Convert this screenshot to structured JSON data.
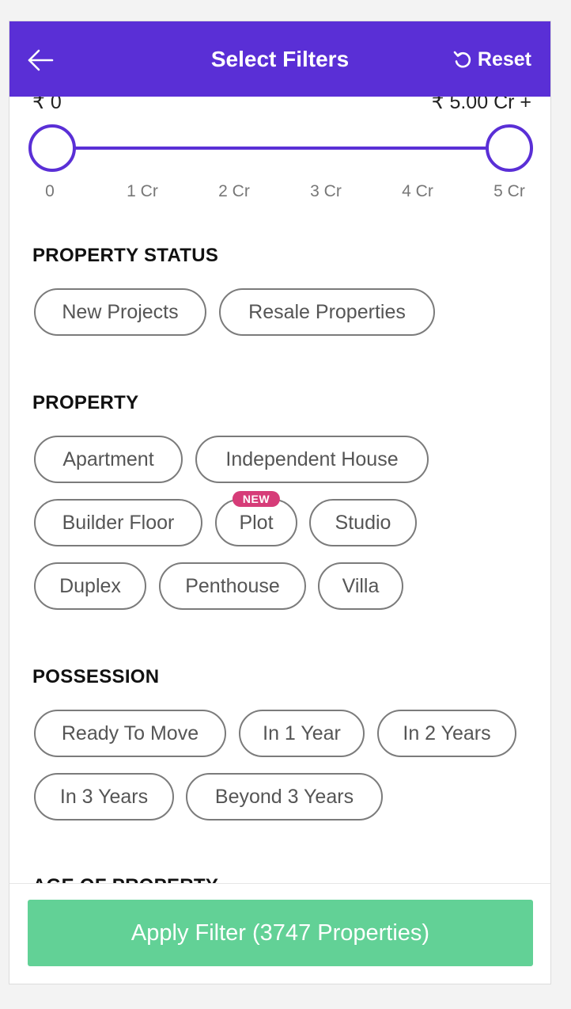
{
  "header": {
    "title": "Select Filters",
    "reset_label": "Reset",
    "back_icon": "arrow-left-icon",
    "reset_icon": "undo-icon",
    "bg_color": "#5a2fd6"
  },
  "budget": {
    "min_label": "₹ 0",
    "max_label": "₹ 5.00 Cr +",
    "ticks": [
      "0",
      "1 Cr",
      "2 Cr",
      "3 Cr",
      "4 Cr",
      "5 Cr"
    ]
  },
  "property_status": {
    "title": "PROPERTY STATUS",
    "options": [
      "New Projects",
      "Resale Properties"
    ]
  },
  "property": {
    "title": "PROPERTY",
    "options": [
      "Apartment",
      "Independent House",
      "Builder Floor",
      "Plot",
      "Studio",
      "Duplex",
      "Penthouse",
      "Villa"
    ],
    "new_badge": "NEW"
  },
  "possession": {
    "title": "POSSESSION",
    "options": [
      "Ready To Move",
      "In 1 Year",
      "In 2 Years",
      "In 3 Years",
      "Beyond 3 Years"
    ]
  },
  "next_section_title": "AGE OF PROPERTY",
  "footer": {
    "apply_label": "Apply Filter (3747 Properties)",
    "apply_color": "#62d196"
  }
}
